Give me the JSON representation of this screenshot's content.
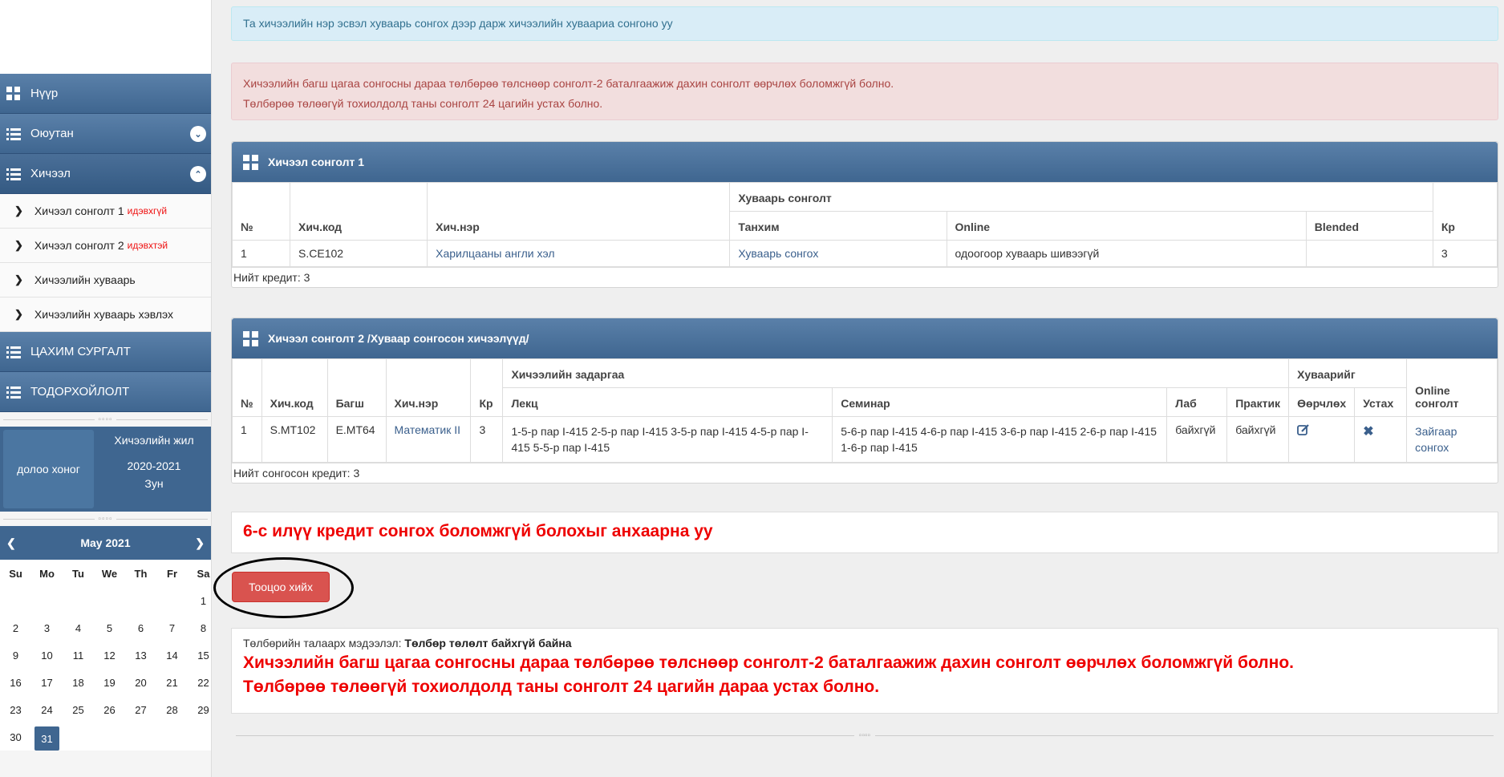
{
  "sidebar": {
    "nav": [
      {
        "label": "Нүүр"
      },
      {
        "label": "Оюутан"
      },
      {
        "label": "Хичээл"
      }
    ],
    "sub_items": [
      {
        "label": "Хичээл сонголт 1",
        "tag": "идэвхгүй"
      },
      {
        "label": "Хичээл сонголт 2",
        "tag": "идэвхтэй"
      },
      {
        "label": "Хичээлийн хуваарь",
        "tag": ""
      },
      {
        "label": "Хичээлийн хуваарь хэвлэх",
        "tag": ""
      }
    ],
    "nav2": [
      {
        "label": "ЦАХИМ СУРГАЛТ"
      },
      {
        "label": "ТОДОРХОЙЛОЛТ"
      }
    ],
    "week_label": "долоо хоног",
    "year_title": "Хичээлийн жил",
    "year_value": "2020-2021",
    "season": "Зун",
    "calendar": {
      "month": "May 2021",
      "days_header": [
        "Su",
        "Mo",
        "Tu",
        "We",
        "Th",
        "Fr",
        "Sa"
      ],
      "selected_day": "31"
    }
  },
  "alerts": {
    "info": "Та хичээлийн нэр эсвэл хуваарь сонгох дээр дарж хичээлийн хуваариа сонгоно уу",
    "danger_line1": "Хичээлийн багш цагаа сонгосны дараа төлбөрөө төлснөөр сонголт-2 баталгаажиж дахин сонголт өөрчлөх боломжгүй болно.",
    "danger_line2": "Төлбөрөө төлөөгүй тохиолдолд таны сонголт 24 цагийн устах болно."
  },
  "panel1": {
    "title": "Хичээл сонголт 1",
    "group_header": "Хуваарь сонголт",
    "headers": {
      "no": "№",
      "code": "Хич.код",
      "name": "Хич.нэр",
      "room": "Танхим",
      "online": "Online",
      "blended": "Blended",
      "cr": "Кр"
    },
    "row": {
      "no": "1",
      "code": "S.CE102",
      "name": "Харилцааны англи хэл",
      "room": "Хуваарь сонгох",
      "online": "одоогоор хуваарь шивээгүй",
      "blended": "",
      "cr": "3"
    },
    "total": "Нийт кредит: 3"
  },
  "panel2": {
    "title": "Хичээл сонголт 2 /Хуваар сонгосон хичээлүүд/",
    "group_breakdown": "Хичээлийн задаргаа",
    "group_schedule": "Хуваарийг",
    "headers": {
      "no": "№",
      "code": "Хич.код",
      "teacher": "Багш",
      "name": "Хич.нэр",
      "cr": "Кр",
      "lecture": "Лекц",
      "seminar": "Семинар",
      "lab": "Лаб",
      "practice": "Практик",
      "change": "Өөрчлөх",
      "delete": "Устах",
      "online": "Online сонголт"
    },
    "row": {
      "no": "1",
      "code": "S.MT102",
      "teacher": "E.MT64",
      "name": "Математик II",
      "cr": "3",
      "lecture": "1-5-р пар I-415 2-5-р пар I-415 3-5-р пар I-415 4-5-р пар I-415 5-5-р пар I-415",
      "seminar": "5-6-р пар I-415 4-6-р пар I-415 3-6-р пар I-415 2-6-р пар I-415 1-6-р пар I-415",
      "lab": "байхгүй",
      "practice": "байхгүй",
      "online": "Зайгаар сонгох"
    },
    "total": "Нийт сонгосон кредит: 3"
  },
  "warning": "6-с илүү кредит сонгох боломжгүй болохыг анхаарна уу",
  "calc_button": "Тооцоо хийх",
  "payment": {
    "label": "Төлбөрийн талаарх мэдээлэл:",
    "status": "Төлбөр төлөлт байхгүй байна",
    "line1": "Хичээлийн багш цагаа сонгосны дараа төлбөрөө төлснөөр сонголт-2 баталгаажиж дахин сонголт өөрчлөх боломжгүй болно.",
    "line2": "Төлбөрөө төлөөгүй тохиолдолд таны сонголт 24 цагийн дараа устах болно."
  },
  "colors": {
    "nav": "#3f6690",
    "danger": "#d9534f",
    "warn_text": "#e00000"
  }
}
